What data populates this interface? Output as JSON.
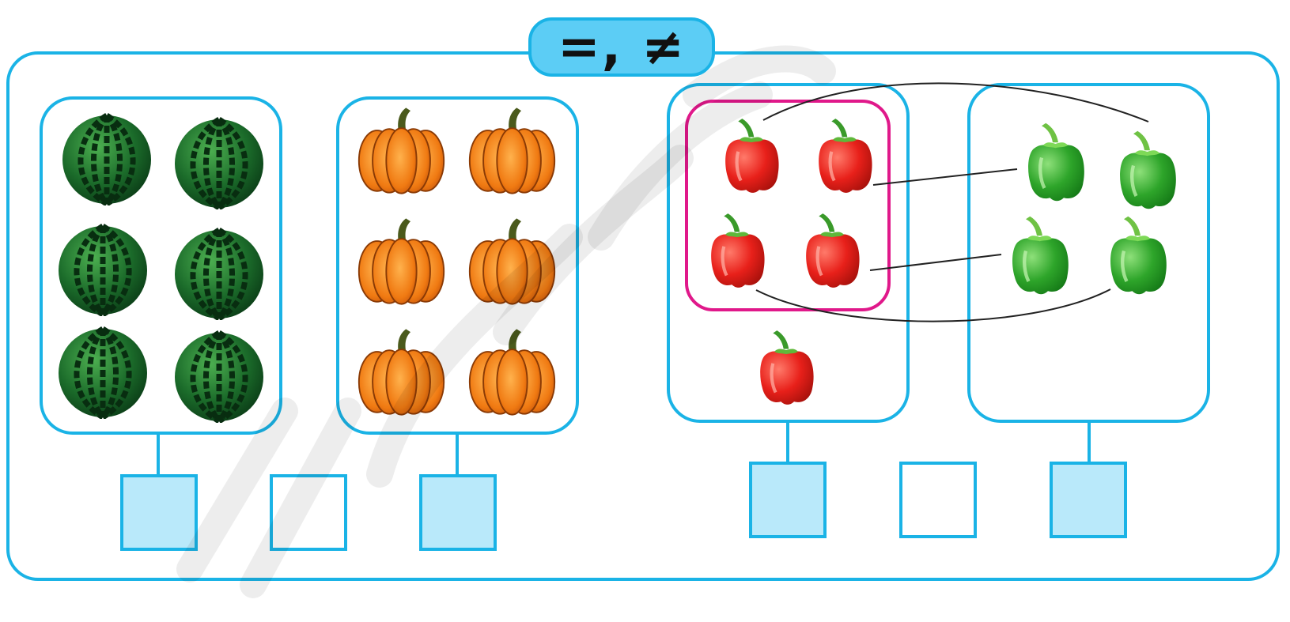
{
  "title": {
    "symbols": "=, ≠"
  },
  "groups": [
    {
      "id": "watermelons",
      "item": "watermelon-icon",
      "count": 6
    },
    {
      "id": "pumpkins",
      "item": "pumpkin-icon",
      "count": 6
    },
    {
      "id": "red-peppers",
      "item": "red-pepper-icon",
      "count": 5,
      "circled": 4
    },
    {
      "id": "green-peppers",
      "item": "green-pepper-icon",
      "count": 4
    }
  ],
  "answer_boxes": {
    "left": [
      {
        "value": ""
      },
      {
        "value": ""
      },
      {
        "value": ""
      }
    ],
    "right": [
      {
        "value": ""
      },
      {
        "value": ""
      },
      {
        "value": ""
      }
    ]
  },
  "colors": {
    "accent": "#1ab3e6",
    "pill": "#5ccdf5",
    "box_fill": "#b9e9fa",
    "circle": "#e0188a"
  }
}
